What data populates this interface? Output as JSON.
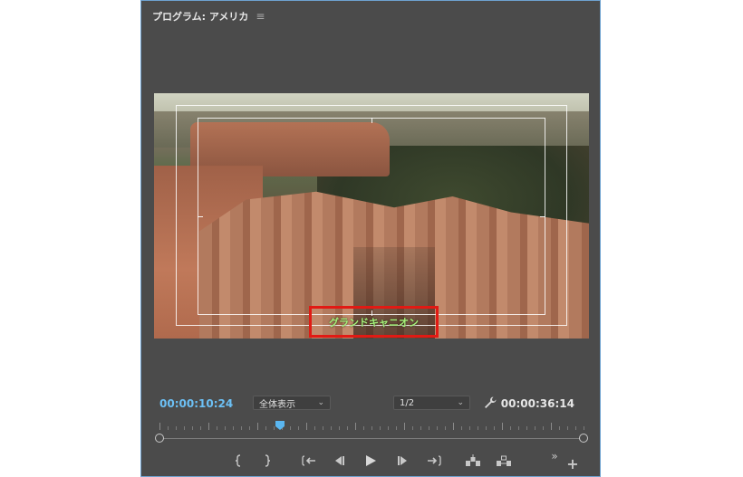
{
  "panel": {
    "title": "プログラム: アメリカ",
    "menu_glyph": "≡"
  },
  "video": {
    "caption": "グランドキャニオン"
  },
  "controls": {
    "current_timecode": "00:00:10:24",
    "zoom_select": "全体表示",
    "resolution_select": "1/2",
    "duration_timecode": "00:00:36:14"
  },
  "timeline": {
    "playhead_fraction": 0.29
  },
  "colors": {
    "panel_bg": "#4b4b4b",
    "current_timecode": "#6cc0f5",
    "caption_text": "#a6f07a",
    "highlight_box": "#e11a14",
    "playhead": "#5ab6f0"
  },
  "icons": [
    "mark-in-icon",
    "mark-out-icon",
    "go-to-in-icon",
    "step-back-icon",
    "play-icon",
    "step-forward-icon",
    "go-to-out-icon",
    "lift-icon",
    "extract-icon",
    "more-icon",
    "add-button-icon",
    "wrench-icon"
  ]
}
